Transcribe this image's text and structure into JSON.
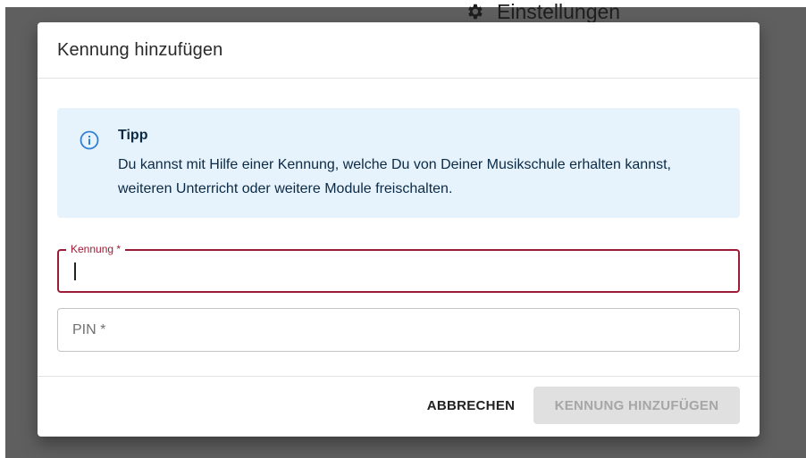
{
  "background": {
    "stray_mark": "„",
    "settings_label": "Einstellungen",
    "settings_icon": "gear-icon"
  },
  "dialog": {
    "title": "Kennung hinzufügen",
    "tip": {
      "icon": "info-circle-icon",
      "title": "Tipp",
      "text": "Du kannst mit Hilfe einer Kennung, welche Du von Deiner Musikschule erhalten kannst, weiteren Unterricht oder weitere Module freischalten."
    },
    "fields": {
      "kennung": {
        "label": "Kennung *",
        "value": ""
      },
      "pin": {
        "placeholder": "PIN *",
        "value": ""
      }
    },
    "actions": {
      "cancel_label": "ABBRECHEN",
      "submit_label": "KENNUNG HINZUFÜGEN",
      "submit_disabled": true
    }
  },
  "colors": {
    "accent": "#9c1b36",
    "tip_background": "#e7f3fc",
    "tip_icon": "#2f7fd4",
    "backdrop": "#5f5f5f",
    "disabled_button": "#e0e0e0"
  }
}
